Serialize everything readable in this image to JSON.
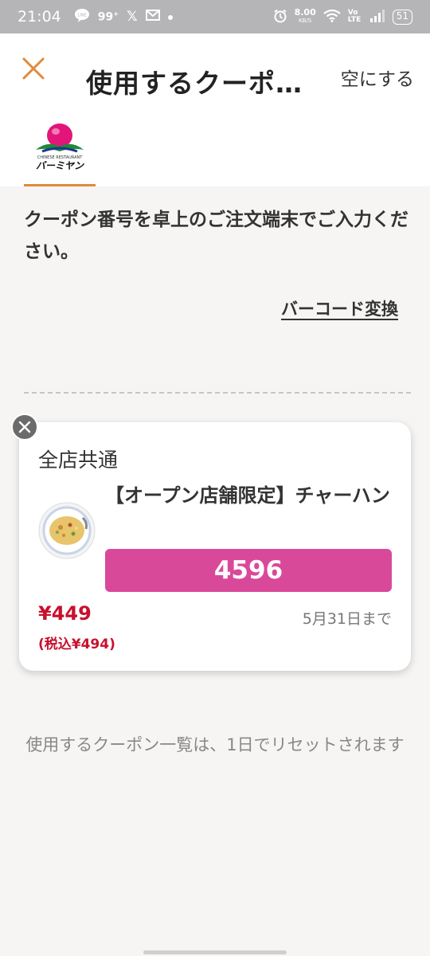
{
  "status_bar": {
    "time": "21:04",
    "net_speed": "8.00",
    "net_unit": "KB/S",
    "volte": "Vo LTE",
    "battery": "51"
  },
  "header": {
    "title": "使用するクーポ…",
    "clear_label": "空にする",
    "accent_color": "#e08a3c"
  },
  "brand": {
    "logo_text": "バーミヤン"
  },
  "main": {
    "instruction": "クーポン番号を卓上のご注文端末でご入力ください。",
    "barcode_link": "バーコード変換"
  },
  "coupon": {
    "scope": "全店共通",
    "item_name": "【オープン店舗限定】チャーハン",
    "code": "4596",
    "code_color": "#d9499a",
    "price": "¥449",
    "price_tax": "(税込¥494)",
    "expiry": "5月31日まで",
    "price_color": "#c8102e"
  },
  "footer": {
    "reset_note": "使用するクーポン一覧は、1日でリセットされます"
  }
}
